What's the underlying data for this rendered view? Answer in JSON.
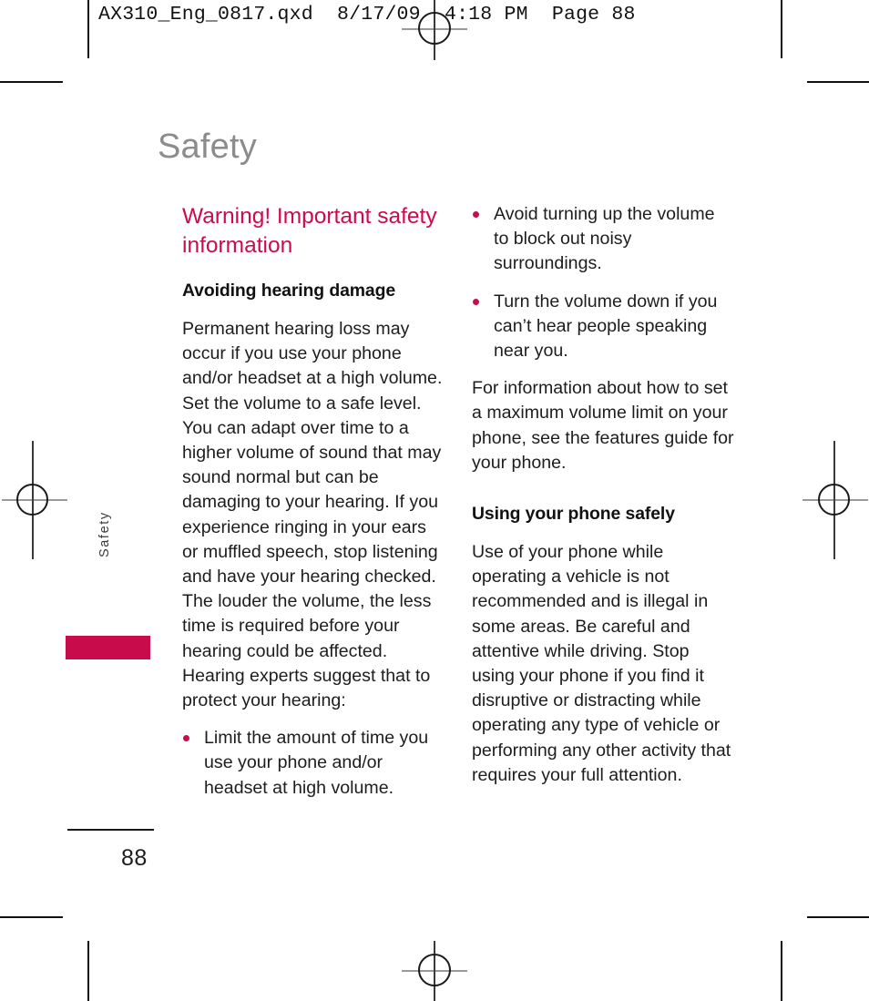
{
  "printer_slug": "AX310_Eng_0817.qxd  8/17/09  4:18 PM  Page 88",
  "chapter": {
    "title": "Safety",
    "margin_tab_label": "Safety"
  },
  "folio": {
    "page_number": "88"
  },
  "colors": {
    "accent": "#cc0b4e",
    "tab_bar": "#c80b4b",
    "chapter_title": "#8c8c8c",
    "body_text": "#1d1d1d"
  },
  "left_column": {
    "warning_heading": "Warning! Important safety information",
    "section_heading": "Avoiding hearing damage",
    "paragraph": "Permanent hearing loss may occur if you use your phone and/or headset at a high volume. Set the volume to a safe level. You can adapt over time to a higher volume of sound that may sound normal but can be damaging to your hearing. If you experience ringing in your ears or muffled speech, stop listening and have your hearing checked. The louder the volume, the less time is required before your hearing could be affected. Hearing experts suggest that to protect your hearing:",
    "bullets": [
      "Limit the amount of time you use your phone and/or headset at high volume."
    ]
  },
  "right_column": {
    "bullets": [
      "Avoid turning up the volume to block out noisy surroundings.",
      "Turn the volume down if you can’t hear people speaking near you."
    ],
    "paragraph": "For information about how to set a maximum volume limit on your phone, see the features guide for your phone.",
    "section_heading": "Using your phone safely",
    "closing_paragraph": "Use of your phone while operating a vehicle is not recommended and is illegal in some areas. Be careful and attentive while driving. Stop using your phone if you find it disruptive or distracting while operating any type of vehicle or performing any other activity that requires your full attention."
  }
}
